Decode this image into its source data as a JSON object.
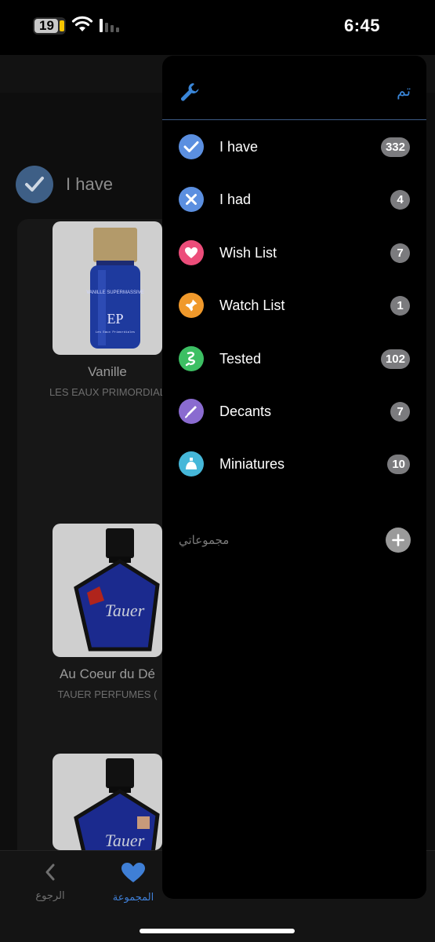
{
  "status_bar": {
    "battery": "19",
    "time": "6:45"
  },
  "background": {
    "header_title": "I have",
    "products": [
      {
        "name": "Vanille",
        "brand": "LES EAUX PRIMORDIAL",
        "bottle_text": "VANILLE SUPERMASSIVE",
        "bottle_brand": "Les Eaux Primordiales"
      },
      {
        "name": "Au Coeur du Dé",
        "brand": "TAUER PERFUMES (",
        "bottle_text": "Tauer"
      },
      {
        "bottle_text": "Tauer"
      }
    ],
    "tabs": [
      {
        "label": "الرجوع",
        "icon": "chevron-left-icon"
      },
      {
        "label": "المجموعة",
        "icon": "heart-icon"
      }
    ]
  },
  "drawer": {
    "done_label": "تم",
    "items": [
      {
        "label": "I have",
        "count": "332",
        "icon": "checkmark-icon",
        "color": "#5b8fe0"
      },
      {
        "label": "I had",
        "count": "4",
        "icon": "x-mark-icon",
        "color": "#5b8fe0"
      },
      {
        "label": "Wish List",
        "count": "7",
        "icon": "heart-icon",
        "color": "#ec4d7a"
      },
      {
        "label": "Watch List",
        "count": "1",
        "icon": "pin-icon",
        "color": "#f0992b"
      },
      {
        "label": "Tested",
        "count": "102",
        "icon": "tester-icon",
        "color": "#3cbf63"
      },
      {
        "label": "Decants",
        "count": "7",
        "icon": "decant-icon",
        "color": "#8a6bd0"
      },
      {
        "label": "Miniatures",
        "count": "10",
        "icon": "miniature-icon",
        "color": "#45b7d9"
      }
    ],
    "collections_label": "مجموعاتي"
  }
}
